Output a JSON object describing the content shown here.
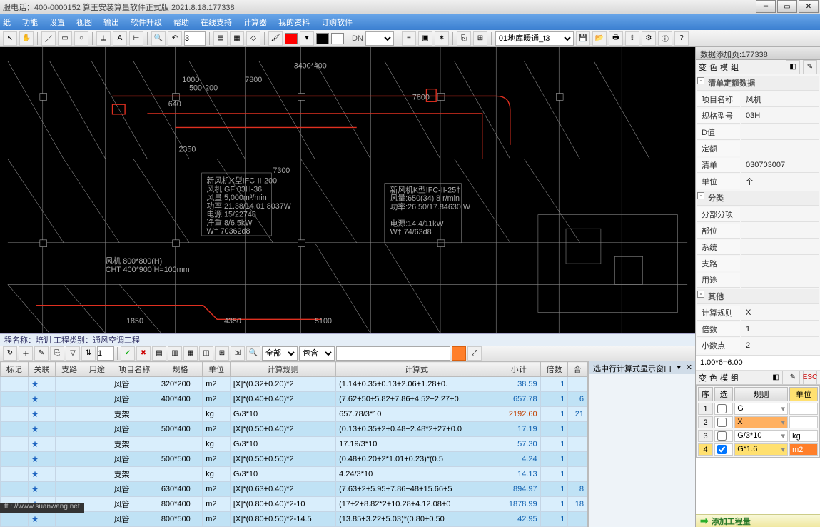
{
  "title": "服电话：400-0000152   算王安装算量软件正式版 2021.8.18.177338",
  "menu": [
    "纸",
    "功能",
    "设置",
    "视图",
    "输出",
    "软件升级",
    "帮助",
    "在线支持",
    "计算器",
    "我的资料",
    "订购软件"
  ],
  "toolbar": {
    "zoom_value": "3",
    "dn_label": "DN",
    "layer_select": "01地库暖通_t3"
  },
  "status": {
    "proj_label": "程名称：培训  工程类别：通风空调工程",
    "filter_all": "全部",
    "filter_contain": "包含"
  },
  "grid": {
    "headers": [
      "标记",
      "关联",
      "支路",
      "用途",
      "项目名称",
      "规格",
      "单位",
      "计算规则",
      "计算式",
      "小计",
      "倍数",
      "合"
    ],
    "rows": [
      {
        "name": "风管",
        "spec": "320*200",
        "unit": "m2",
        "rule": "[X]*(0.32+0.20)*2",
        "expr": "(1.14+0.35+0.13+2.06+1.28+0.",
        "sub": "38.59",
        "mul": "1",
        "tot": ""
      },
      {
        "name": "风管",
        "spec": "400*400",
        "unit": "m2",
        "rule": "[X]*(0.40+0.40)*2",
        "expr": "(7.62+50+5.82+7.86+4.52+2.27+0.",
        "sub": "657.78",
        "mul": "1",
        "tot": "6"
      },
      {
        "name": "支架",
        "spec": "",
        "unit": "kg",
        "rule": "G/3*10",
        "expr": "657.78/3*10",
        "sub": "2192.60",
        "mul": "1",
        "tot": "21",
        "hot": true
      },
      {
        "name": "风管",
        "spec": "500*400",
        "unit": "m2",
        "rule": "[X]*(0.50+0.40)*2",
        "expr": "(0.13+0.35+2+0.48+2.48*2+27+0.0",
        "sub": "17.19",
        "mul": "1",
        "tot": ""
      },
      {
        "name": "支架",
        "spec": "",
        "unit": "kg",
        "rule": "G/3*10",
        "expr": "17.19/3*10",
        "sub": "57.30",
        "mul": "1",
        "tot": ""
      },
      {
        "name": "风管",
        "spec": "500*500",
        "unit": "m2",
        "rule": "[X]*(0.50+0.50)*2",
        "expr": "(0.48+0.20+2*1.01+0.23)*(0.5",
        "sub": "4.24",
        "mul": "1",
        "tot": ""
      },
      {
        "name": "支架",
        "spec": "",
        "unit": "kg",
        "rule": "G/3*10",
        "expr": "4.24/3*10",
        "sub": "14.13",
        "mul": "1",
        "tot": ""
      },
      {
        "name": "风管",
        "spec": "630*400",
        "unit": "m2",
        "rule": "[X]*(0.63+0.40)*2",
        "expr": "(7.63+2+5.95+7.86+48+15.66+5",
        "sub": "894.97",
        "mul": "1",
        "tot": "8"
      },
      {
        "name": "风管",
        "spec": "800*400",
        "unit": "m2",
        "rule": "[X]*(0.80+0.40)*2-10",
        "expr": "(17+2+8.82*2+10.28+4.12.08+0",
        "sub": "1878.99",
        "mul": "1",
        "tot": "18"
      },
      {
        "name": "风管",
        "spec": "800*500",
        "unit": "m2",
        "rule": "[X]*(0.80+0.50)*2-14.5",
        "expr": "(13.85+3.22+5.03)*(0.80+0.50",
        "sub": "42.95",
        "mul": "1",
        "tot": ""
      }
    ]
  },
  "sidepane": {
    "title": "选中行计算式显示窗口"
  },
  "rpanel": {
    "title": "数据添加页:177338",
    "tabs": [
      "变",
      "色",
      "模",
      "组"
    ],
    "groups": {
      "g1": "清单定额数据",
      "g2": "分类",
      "g3": "其他"
    },
    "props": [
      {
        "k": "项目名称",
        "v": "风机"
      },
      {
        "k": "规格型号",
        "v": "03H"
      },
      {
        "k": "D值",
        "v": ""
      },
      {
        "k": "定额",
        "v": ""
      },
      {
        "k": "清单",
        "v": "030703007"
      },
      {
        "k": "单位",
        "v": "个"
      }
    ],
    "props2": [
      {
        "k": "分部分项",
        "v": ""
      },
      {
        "k": "部位",
        "v": ""
      },
      {
        "k": "系统",
        "v": ""
      },
      {
        "k": "支路",
        "v": ""
      },
      {
        "k": "用途",
        "v": ""
      }
    ],
    "props3": [
      {
        "k": "计算规则",
        "v": "X"
      },
      {
        "k": "倍数",
        "v": "1"
      },
      {
        "k": "小数点",
        "v": "2"
      }
    ],
    "formula": "1.00*6=6.00",
    "mini_headers": [
      "序",
      "选",
      "规则",
      "单位"
    ],
    "mini_rows": [
      {
        "n": "1",
        "chk": false,
        "rule": "G",
        "unit": ""
      },
      {
        "n": "2",
        "chk": false,
        "rule": "X",
        "unit": "",
        "sel_rule": true
      },
      {
        "n": "3",
        "chk": false,
        "rule": "G/3*10",
        "unit": "kg"
      },
      {
        "n": "4",
        "chk": true,
        "rule": "G*1.6",
        "unit": "m2",
        "sel_row": true
      }
    ],
    "footer_cmd": "添加工程量"
  },
  "url": "tt : //www.suanwang.net"
}
